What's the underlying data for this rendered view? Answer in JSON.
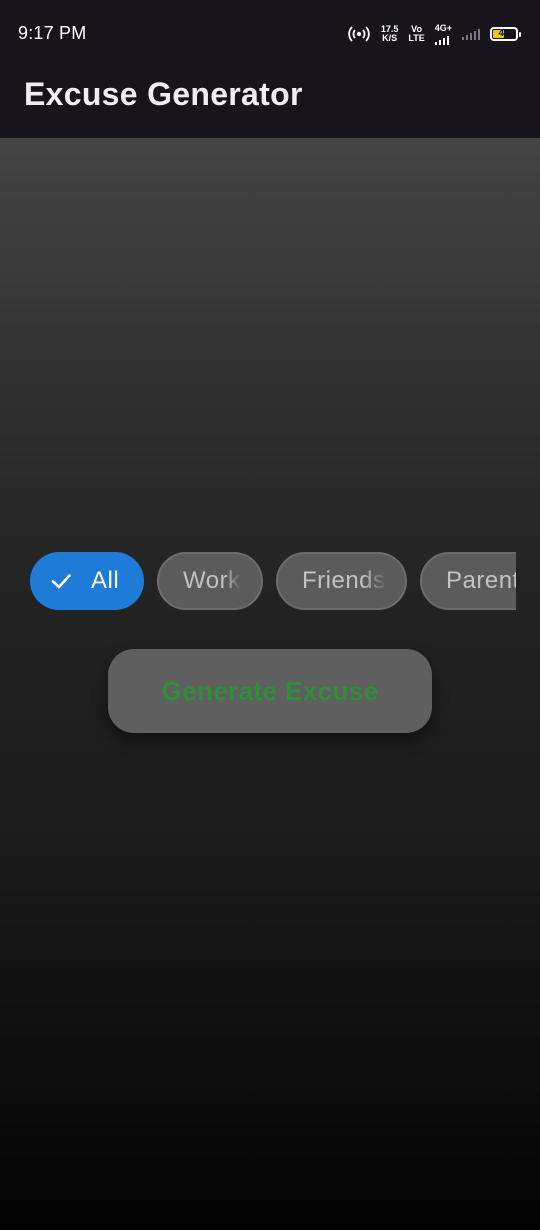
{
  "status_bar": {
    "time": "9:17 PM",
    "net_speed_value": "17.5",
    "net_speed_unit": "K/S",
    "volte_top": "Vo",
    "volte_bottom": "LTE",
    "network_type": "4G+",
    "battery_level": "45",
    "battery_color": "#f3c51f",
    "icons": [
      "hotspot-icon",
      "signal-icon",
      "battery-icon"
    ]
  },
  "app_bar": {
    "title": "Excuse Generator",
    "background": "#17151b"
  },
  "filters": {
    "chips": [
      {
        "label": "All",
        "selected": true,
        "icon": "check-icon"
      },
      {
        "label": "Work",
        "selected": false
      },
      {
        "label": "Friends",
        "selected": false
      },
      {
        "label": "Parents",
        "selected": false
      }
    ],
    "selected_color": "#1f7bd8"
  },
  "generate_button": {
    "label": "Generate Excuse",
    "text_color": "#2f8f3a"
  }
}
